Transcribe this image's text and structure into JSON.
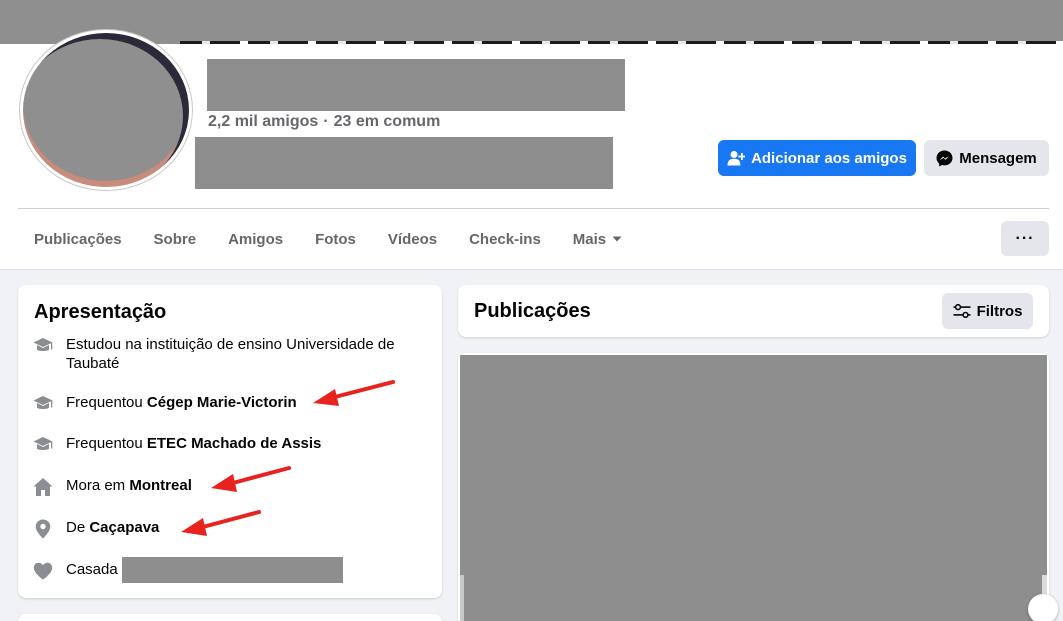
{
  "profile": {
    "friends_count": "2,2 mil amigos",
    "separator": "·",
    "mutual": "23 em comum",
    "add_friend_label": "Adicionar aos amigos",
    "message_label": "Mensagem"
  },
  "tabs": [
    {
      "label": "Publicações"
    },
    {
      "label": "Sobre"
    },
    {
      "label": "Amigos"
    },
    {
      "label": "Fotos"
    },
    {
      "label": "Vídeos"
    },
    {
      "label": "Check-ins"
    },
    {
      "label": "Mais"
    }
  ],
  "more_menu": {
    "label": "···"
  },
  "intro": {
    "title": "Apresentação",
    "items": [
      {
        "icon": "graduation-cap-icon",
        "prefix": "Estudou na instituição de ensino Universidade de Taubaté",
        "bold": ""
      },
      {
        "icon": "graduation-cap-icon",
        "prefix": "Frequentou ",
        "bold": "Cégep Marie-Victorin"
      },
      {
        "icon": "graduation-cap-icon",
        "prefix": "Frequentou ",
        "bold": "ETEC Machado de Assis"
      },
      {
        "icon": "home-icon",
        "prefix": "Mora em ",
        "bold": "Montreal"
      },
      {
        "icon": "location-pin-icon",
        "prefix": "De ",
        "bold": "Caçapava"
      },
      {
        "icon": "heart-icon",
        "prefix": "Casada ",
        "bold": ""
      }
    ]
  },
  "posts": {
    "title": "Publicações",
    "filter_label": "Filtros"
  },
  "colors": {
    "primary": "#1877f2",
    "secondary_button": "#e4e6eb",
    "muted_text": "#65676b",
    "annotation_arrow": "#e8231d",
    "redaction": "#8e8e8e"
  }
}
